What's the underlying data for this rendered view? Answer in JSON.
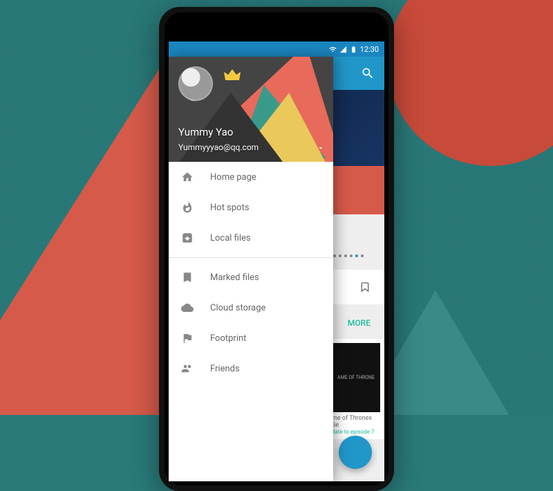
{
  "status": {
    "time": "12:30"
  },
  "drawer": {
    "user_name": "Yummy Yao",
    "user_email": "Yummyyyao@qq.com",
    "section1": [
      {
        "icon": "home",
        "label": "Home page"
      },
      {
        "icon": "fire",
        "label": "Hot spots"
      },
      {
        "icon": "download",
        "label": "Local files"
      }
    ],
    "section2": [
      {
        "icon": "bookmark",
        "label": "Marked files"
      },
      {
        "icon": "cloud",
        "label": "Cloud storage"
      },
      {
        "icon": "flag",
        "label": "Footprint"
      },
      {
        "icon": "people",
        "label": "Friends"
      }
    ]
  },
  "behind": {
    "more_label": "MORE",
    "thumb_text": "AME OF THRONE",
    "card_meta": "me of Thrones Se",
    "card_sub": "date to episode 7"
  }
}
